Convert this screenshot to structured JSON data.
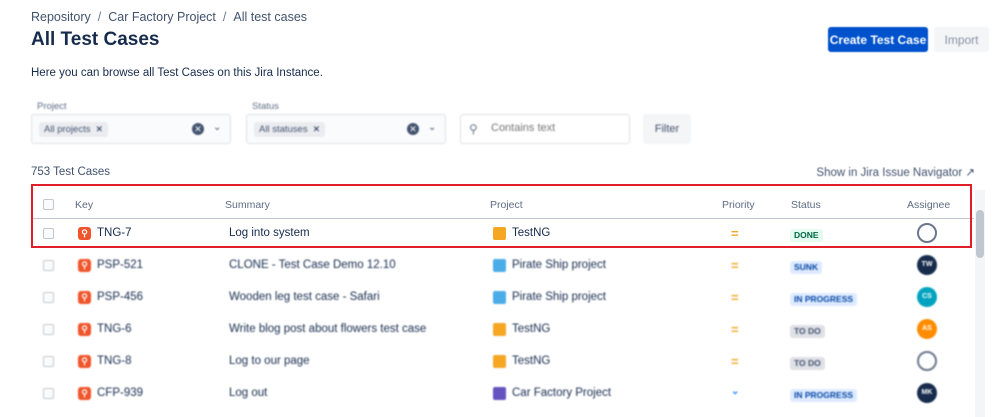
{
  "breadcrumb": [
    "Repository",
    "Car Factory Project",
    "All test cases"
  ],
  "breadcrumb_sep": "/",
  "page_title": "All Test Cases",
  "buttons": {
    "create": "Create Test Case",
    "import": "Import",
    "filter": "Filter"
  },
  "intro": "Here you can browse all Test Cases on this Jira Instance.",
  "filters": {
    "project": {
      "label": "Project",
      "value": "All projects"
    },
    "status": {
      "label": "Status",
      "value": "All statuses"
    },
    "search_placeholder": "Contains text"
  },
  "count": "753 Test Cases",
  "issue_navigator_link": "Show in Jira Issue Navigator",
  "columns": {
    "key": "Key",
    "summary": "Summary",
    "project": "Project",
    "priority": "Priority",
    "status": "Status",
    "assignee": "Assignee"
  },
  "rows": [
    {
      "key": "TNG-7",
      "summary": "Log into system",
      "project": "TestNG",
      "priority": "=",
      "status": "DONE",
      "assignee": ""
    },
    {
      "key": "PSP-521",
      "summary": "CLONE - Test Case Demo 12.10",
      "project": "Pirate Ship project",
      "priority": "=",
      "status": "SUNK",
      "assignee": "TW"
    },
    {
      "key": "PSP-456",
      "summary": "Wooden leg test case - Safari",
      "project": "Pirate Ship project",
      "priority": "=",
      "status": "IN PROGRESS",
      "assignee": "CS"
    },
    {
      "key": "TNG-6",
      "summary": "Write blog post about flowers test case",
      "project": "TestNG",
      "priority": "=",
      "status": "TO DO",
      "assignee": "AS"
    },
    {
      "key": "TNG-8",
      "summary": "Log to our page",
      "project": "TestNG",
      "priority": "=",
      "status": "TO DO",
      "assignee": ""
    },
    {
      "key": "CFP-939",
      "summary": "Log out",
      "project": "Car Factory Project",
      "priority": "⌄",
      "status": "IN PROGRESS",
      "assignee": "MK"
    }
  ],
  "colors": {
    "accent": "#0052cc",
    "highlight": "#e11d2a",
    "done": "#00875a",
    "issue": "#f0542a"
  }
}
